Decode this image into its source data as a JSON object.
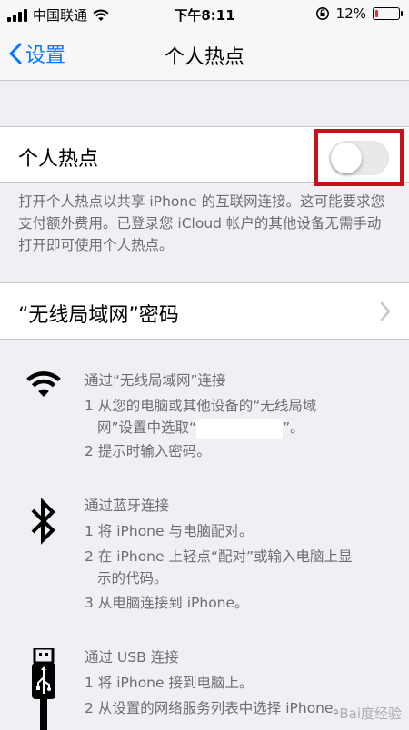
{
  "status_bar": {
    "carrier": "中国联通",
    "time": "下午8:11",
    "battery_percent": "12%",
    "battery_level": 0.12
  },
  "nav": {
    "back_label": "设置",
    "title": "个人热点"
  },
  "hotspot": {
    "label": "个人热点",
    "toggle_on": false,
    "footnote": "打开个人热点以共享 iPhone 的互联网连接。这可能要求您支付额外费用。已登录您 iCloud 帐户的其他设备无需手动打开即可使用个人热点。"
  },
  "wifi_password": {
    "label": "“无线局域网”密码"
  },
  "instructions": {
    "wifi": {
      "heading": "通过“无线局域网”连接",
      "step1_prefix": "1 从您的电脑或其他设备的“无线局域",
      "step1_line2": "网”设置中选取“",
      "step1_suffix": "”。",
      "step2": "2 提示时输入密码。"
    },
    "bluetooth": {
      "heading": "通过蓝牙连接",
      "step1": "1 将 iPhone 与电脑配对。",
      "step2_line1": "2 在 iPhone 上轻点“配对”或输入电脑上显",
      "step2_line2": "示的代码。",
      "step3": "3 从电脑连接到 iPhone。"
    },
    "usb": {
      "heading": "通过 USB 连接",
      "step1": "1 将 iPhone 接到电脑上。",
      "step2": "2 从设置的网络服务列表中选择 iPhone。"
    }
  },
  "watermark": "Bai度经验",
  "icons": {
    "back": "chevron-left-icon",
    "wifi": "wifi-icon",
    "bluetooth": "bluetooth-icon",
    "usb": "usb-icon",
    "chevron": "chevron-right-icon"
  },
  "colors": {
    "accent": "#007aff",
    "highlight_box": "#c8101a",
    "battery_low": "#e0332b"
  }
}
